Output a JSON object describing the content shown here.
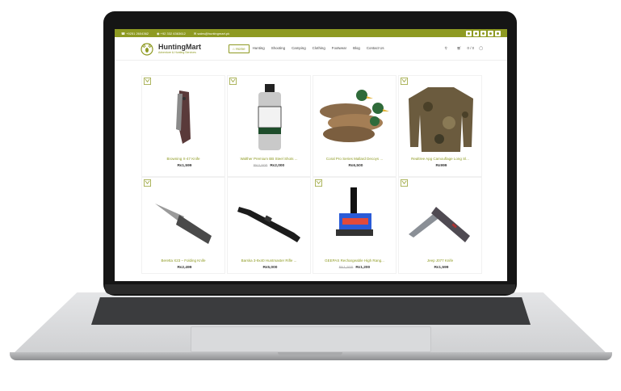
{
  "topbar": {
    "phone1": "+9251 2604362",
    "phone2": "+92 332 6363612",
    "email": "sales@huntingmart.pk"
  },
  "header": {
    "brand": "HuntingMart",
    "tagline": "Adventure & Hunting Services",
    "nav": [
      "Home",
      "Hunting",
      "Shooting",
      "Camping",
      "Clothing",
      "Footwear",
      "Blog",
      "Contact Us"
    ],
    "cart": "0 / 0"
  },
  "products": [
    {
      "name": "Browning X-47 Knife",
      "old_price": "",
      "price": "₨1,599"
    },
    {
      "name": "Walther Premium BB Steel Shots ...",
      "old_price": "₨2,500",
      "price": "₨2,000"
    },
    {
      "name": "Coral Pro Series Mallard Decoys ...",
      "old_price": "",
      "price": "₨6,500"
    },
    {
      "name": "Realtree Apg Camouflage Long Sl...",
      "old_price": "",
      "price": "₨999"
    },
    {
      "name": "Beretta X23 – Folding Knife",
      "old_price": "",
      "price": "₨2,499"
    },
    {
      "name": "Barska 3-9x40 Huntmaster Rifle ...",
      "old_price": "",
      "price": "₨5,000"
    },
    {
      "name": "GEEPAS Rechargeable High Rang...",
      "old_price": "₨1,500",
      "price": "₨1,200"
    },
    {
      "name": "Jeep J077 Knife",
      "old_price": "",
      "price": "₨1,599"
    }
  ],
  "colors": {
    "accent": "#8e9a22"
  }
}
